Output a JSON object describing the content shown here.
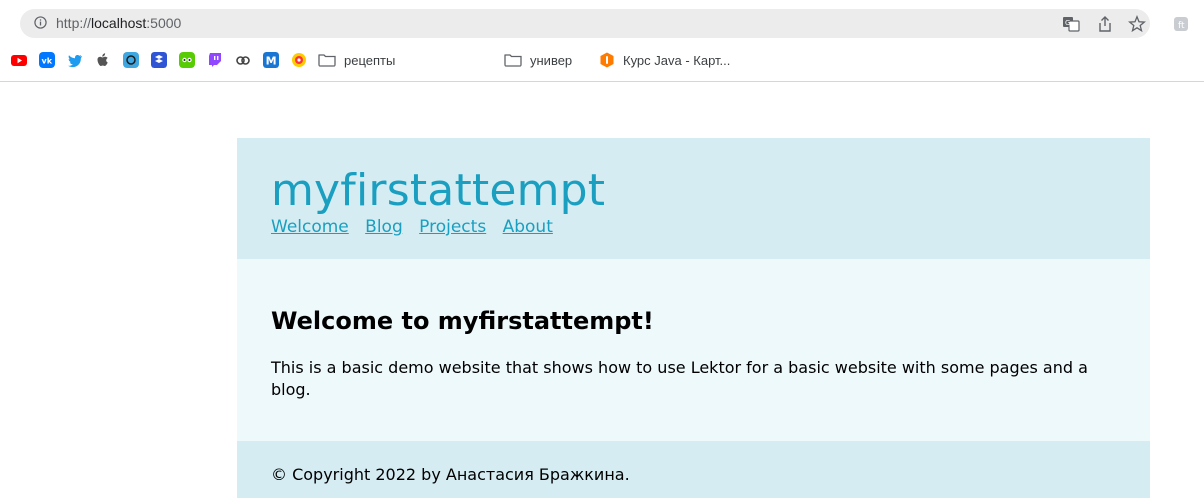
{
  "browser": {
    "url_scheme": "http://",
    "url_host": "localhost",
    "url_port": ":5000",
    "bookmarks": [
      {
        "icon": "youtube-icon",
        "color": "#ff0000"
      },
      {
        "icon": "vk-icon",
        "color": "#0077ff"
      },
      {
        "icon": "twitter-icon",
        "color": "#1d9bf0"
      },
      {
        "icon": "apple-icon",
        "color": "#555555"
      },
      {
        "icon": "bookmark-app-icon-1",
        "color": "#3fa7e0"
      },
      {
        "icon": "bookmark-app-icon-2",
        "color": "#2f55d4"
      },
      {
        "icon": "duolingo-icon",
        "color": "#58cc02"
      },
      {
        "icon": "twitch-icon",
        "color": "#9146ff"
      },
      {
        "icon": "creative-cloud-icon",
        "color": "#444444"
      },
      {
        "icon": "m-icon",
        "color": "#1976d2"
      },
      {
        "icon": "yandex-music-icon",
        "color": "#ffcc00"
      }
    ],
    "folders": [
      {
        "label": "рецепты"
      },
      {
        "label": "универ"
      }
    ],
    "bookmark_link": {
      "label": "Курс Java - Карт...",
      "color": "#ff7a00"
    }
  },
  "site": {
    "title": "myfirstattempt",
    "nav": [
      "Welcome",
      "Blog",
      "Projects",
      "About"
    ],
    "heading": "Welcome to myfirstattempt!",
    "description": "This is a basic demo website that shows how to use Lektor for a basic website with some pages and a blog.",
    "footer": "© Copyright 2022 by Анастасия Бражкина.",
    "colors": {
      "header": "#d4ecf2",
      "body": "#eef9fc",
      "accent": "#1a9fc0"
    }
  }
}
